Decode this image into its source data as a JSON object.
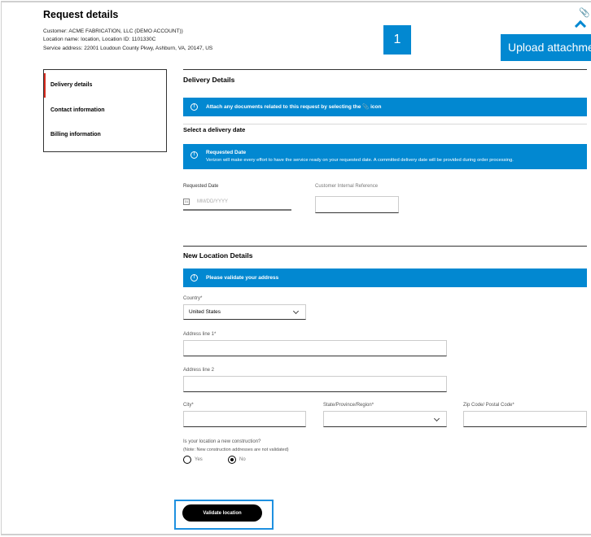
{
  "header": {
    "title": "Request details",
    "customer": "Customer: ACME FABRICATION, LLC (DEMO ACCOUNT))",
    "location": "Location name: location, Location ID: 1101330C",
    "service_address": "Service address: 22001 Loudoun County Pkwy, Ashburn, VA, 20147, US",
    "badge": "1",
    "upload_label": "Upload attachment"
  },
  "sidebar": {
    "items": [
      {
        "label": "Delivery details"
      },
      {
        "label": "Contact information"
      },
      {
        "label": "Billing information"
      }
    ]
  },
  "delivery": {
    "heading": "Delivery Details",
    "attach_banner": "Attach any documents related to this request by selecting the",
    "attach_banner_end": "icon",
    "select_date": "Select a delivery date",
    "req_banner_title": "Requested Date",
    "req_banner_text": "Verizon will make every effort to have the service ready on your requested date. A committed delivery date will be provided during order processing.",
    "requested_date_label": "Requested Date",
    "date_placeholder": "MM/DD/YYYY",
    "reference_label": "Customer Internal Reference",
    "reference_value": ""
  },
  "location": {
    "heading": "New Location Details",
    "banner": "Please validate your address",
    "country_label": "Country*",
    "country_value": "United States",
    "address1_label": "Address line 1*",
    "address2_label": "Address line 2",
    "city_label": "City*",
    "state_label": "State/Province/Region*",
    "state_value": "",
    "zip_label": "Zip Code/ Postal Code*",
    "question": "Is your location a new construction?",
    "note": "(Note: New construction addresses are not validated)",
    "yes": "Yes",
    "no": "No",
    "selected": "No",
    "validate_label": "Validate location"
  },
  "colors": {
    "accent": "#0288d1",
    "active": "#d52b1e"
  }
}
